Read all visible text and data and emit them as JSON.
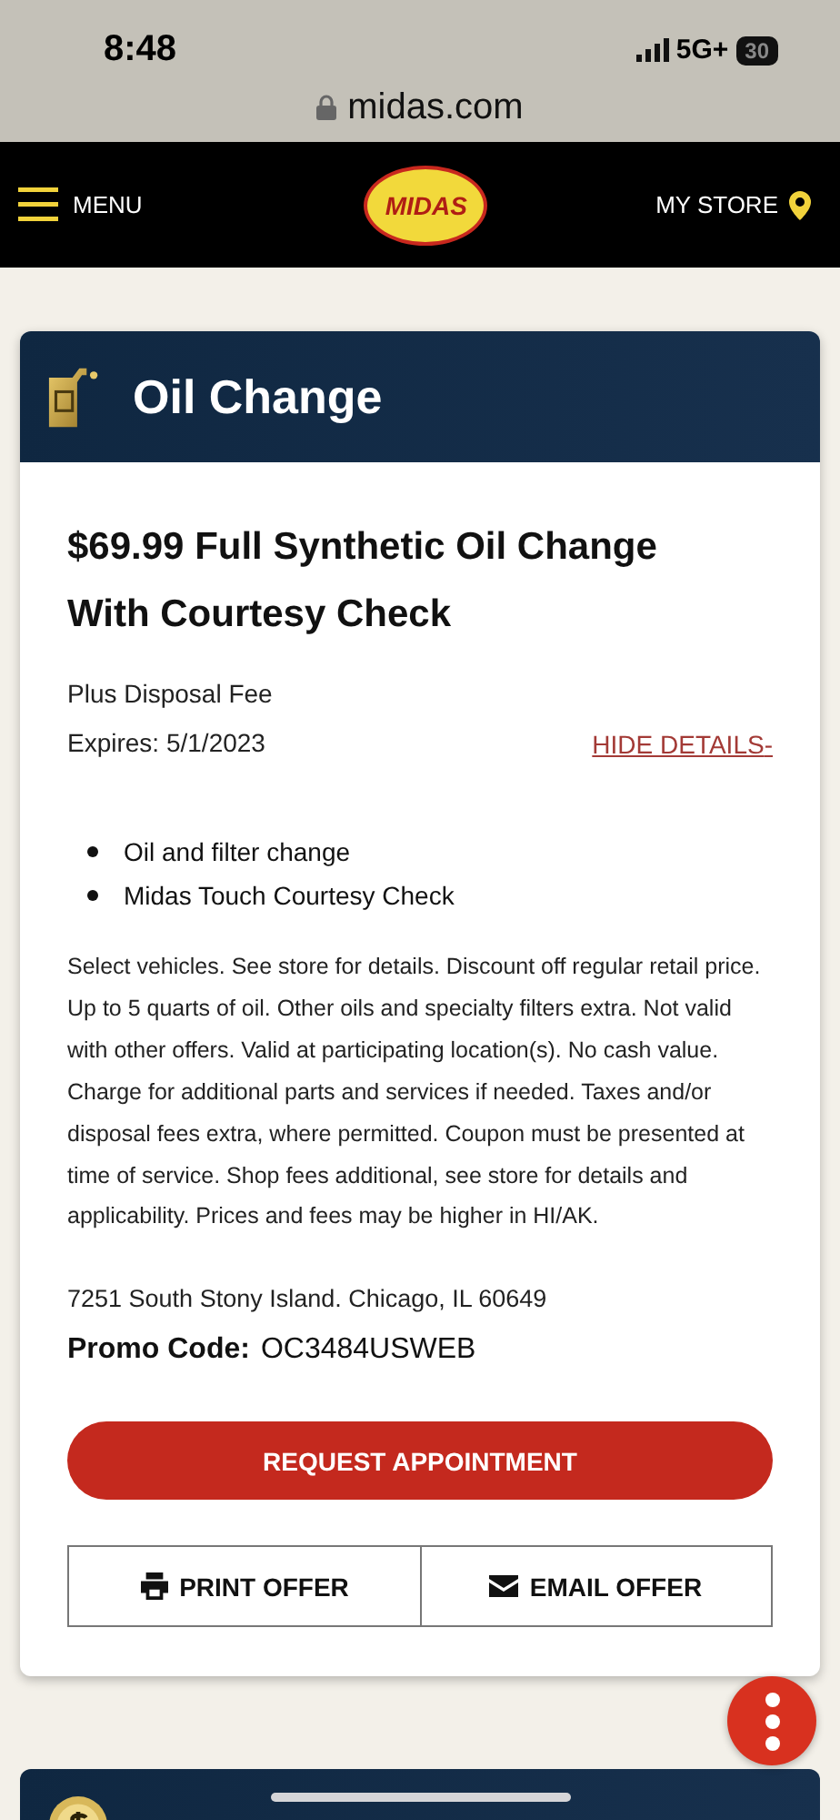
{
  "status_bar": {
    "time": "8:48",
    "network": "5G+",
    "battery": "30"
  },
  "address_bar": {
    "url": "midas.com"
  },
  "nav": {
    "menu": "MENU",
    "logo": "MIDAS",
    "store": "MY STORE"
  },
  "offer": {
    "category": "Oil Change",
    "title": "$69.99 Full Synthetic Oil Change With Courtesy Check",
    "subtitle": "Plus Disposal Fee",
    "expires": "Expires: 5/1/2023",
    "toggle": "HIDE DETAILS",
    "toggle_mark": "-",
    "bullets": [
      "Oil and filter change",
      "Midas Touch Courtesy Check"
    ],
    "fine_print": "Select vehicles. See store for details. Discount off regular retail price. Up to 5 quarts of oil. Other oils and specialty filters extra. Not valid with other offers. Valid at participating location(s). No cash value. Charge for additional parts and services if needed. Taxes and/or disposal fees extra, where permitted. Coupon must be presented at time of service. Shop fees additional, see store for details and applicability. Prices and fees may be higher in HI/AK.",
    "address": "7251 South Stony Island. Chicago, IL 60649",
    "promo_label": "Promo Code:",
    "promo_code": "OC3484USWEB",
    "request_button": "REQUEST APPOINTMENT",
    "print_button": "PRINT OFFER",
    "email_button": "EMAIL OFFER"
  }
}
